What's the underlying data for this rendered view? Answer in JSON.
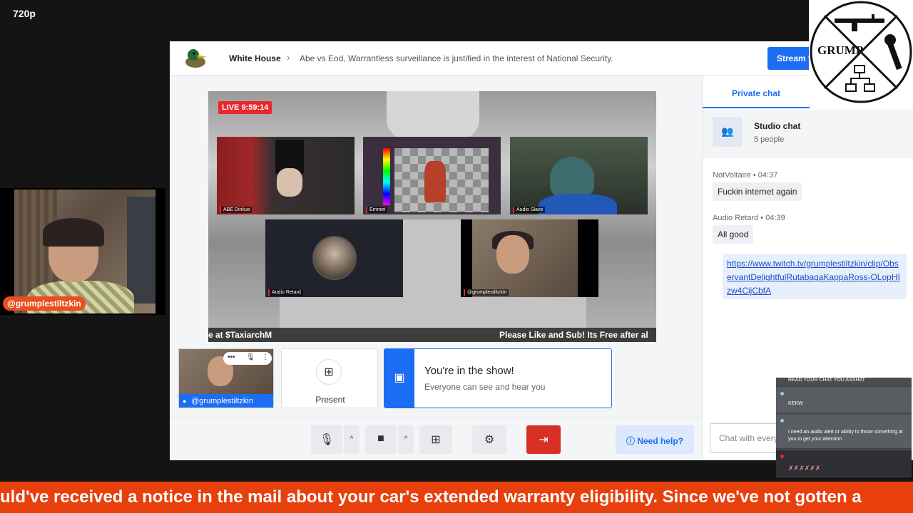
{
  "quality_label": "720p",
  "webcam": {
    "username": "@grumplestiltzkin"
  },
  "studio": {
    "breadcrumb_root": "White House",
    "breadcrumb_separator": "›",
    "broadcast_title": "Abe vs Eod, Warrantless surveillance is justified in the interest of National Security.",
    "stream_button": "Stream t",
    "live_badge": "LIVE 9:59:14",
    "participants": [
      {
        "label": "ABE Dinkus"
      },
      {
        "label": "Emmet"
      },
      {
        "label": "Audio Slave"
      },
      {
        "label": "Audio Retard"
      },
      {
        "label": "@grumplestiltzkin"
      }
    ],
    "ticker_left": "e at $TaxiarchM",
    "ticker_right": "Please Like and Sub! Its Free after al",
    "self_tile_name": "@grumplestiltzkin",
    "self_controls": {
      "dots": "•••",
      "mic": "🎙",
      "menu": "⋮"
    },
    "present_label": "Present",
    "show_card": {
      "title": "You're in the show!",
      "subtitle": "Everyone can see and hear you"
    },
    "toolbar": {
      "mic_icon": "🎙",
      "caret": "^",
      "cam_icon": "■",
      "share_icon": "⊞",
      "settings_icon": "⚙",
      "leave_icon": "⇥",
      "help_label": "Need help?"
    },
    "chat": {
      "tab_label": "Private chat",
      "studio_chat_title": "Studio chat",
      "studio_chat_count": "5 people",
      "messages": [
        {
          "author": "NotVoltaire",
          "time": "04:37",
          "text": "Fuckin internet again"
        },
        {
          "author": "Audio Retard",
          "time": "04:39",
          "text": "All good"
        }
      ],
      "link_message": "https://www.twitch.tv/grumplestiltzkin/clip/ObservantDelightfulRutabagaKappaRoss-OLopHIzw4CijCbfA",
      "input_placeholder": "Chat with everyone",
      "meta_separator": "•"
    }
  },
  "logo": {
    "text": "GRUMP",
    "icon_names": [
      "rifle-icon",
      "wrench-icon",
      "network-icon"
    ]
  },
  "overlay": {
    "rows": [
      {
        "name": "",
        "text": "READ YOUR CHAT YOU ASSHAT"
      },
      {
        "name": "",
        "text": "KEKW"
      },
      {
        "name": "",
        "text": "I need an audio alert or ability to throw something at you to get your attention"
      },
      {
        "name": "",
        "text": "✗✗✗✗✗✗"
      }
    ]
  },
  "bottom_ticker": "uld've received a notice in the mail about your car's extended warranty eligibility. Since we've not gotten a",
  "colors": {
    "accent": "#1b6ef3",
    "live": "#e9262c",
    "ticker": "#e8400c",
    "leave": "#d93025"
  }
}
